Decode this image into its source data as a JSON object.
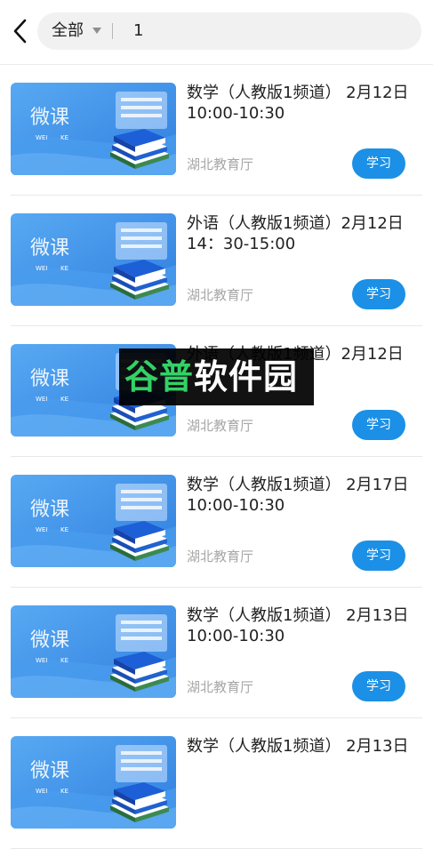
{
  "header": {
    "filter_label": "全部",
    "search_value": "1"
  },
  "items": [
    {
      "thumb_title": "微课",
      "thumb_sub_left": "WEI",
      "thumb_sub_right": "KE",
      "title": "数学（人教版1频道） 2月12日 10:00-10:30",
      "source": "湖北教育厅",
      "button": "学习"
    },
    {
      "thumb_title": "微课",
      "thumb_sub_left": "WEI",
      "thumb_sub_right": "KE",
      "title": "外语（人教版1频道）2月12日 14：30-15:00",
      "source": "湖北教育厅",
      "button": "学习"
    },
    {
      "thumb_title": "微课",
      "thumb_sub_left": "WEI",
      "thumb_sub_right": "KE",
      "title": "外语（人教版1频道）2月12日",
      "source": "湖北教育厅",
      "button": "学习"
    },
    {
      "thumb_title": "微课",
      "thumb_sub_left": "WEI",
      "thumb_sub_right": "KE",
      "title": "数学（人教版1频道） 2月17日 10:00-10:30",
      "source": "湖北教育厅",
      "button": "学习"
    },
    {
      "thumb_title": "微课",
      "thumb_sub_left": "WEI",
      "thumb_sub_right": "KE",
      "title": "数学（人教版1频道） 2月13日 10:00-10:30",
      "source": "湖北教育厅",
      "button": "学习"
    },
    {
      "thumb_title": "微课",
      "thumb_sub_left": "WEI",
      "thumb_sub_right": "KE",
      "title": "数学（人教版1频道） 2月13日",
      "source": "湖北教育厅",
      "button": "学习"
    }
  ],
  "watermark": {
    "part1": "谷普",
    "part2": "软件园"
  },
  "colors": {
    "accent": "#1b90e6",
    "thumb_bg": "#3d8fe6",
    "watermark_green": "#33d266"
  }
}
